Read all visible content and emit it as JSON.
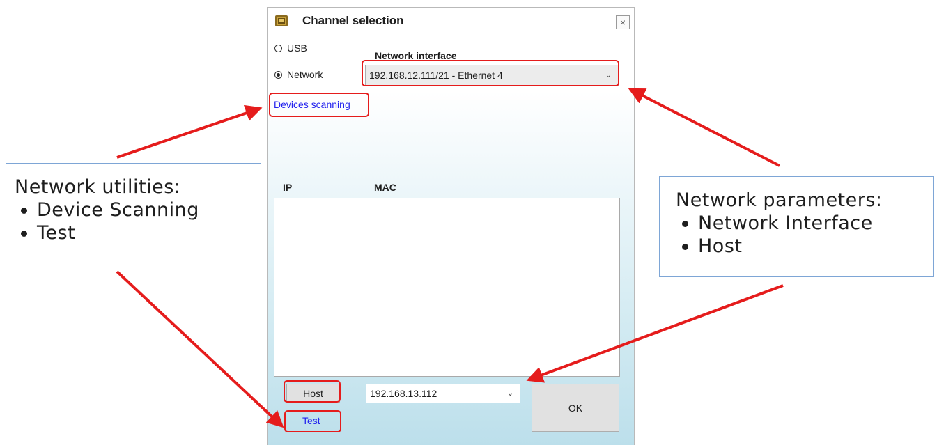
{
  "dialog": {
    "title": "Channel selection",
    "close_symbol": "×",
    "app_icon": "module-icon"
  },
  "channel": {
    "usb_label": "USB",
    "network_label": "Network",
    "selected": "Network"
  },
  "network_interface": {
    "label": "Network interface",
    "value": "192.168.12.111/21 - Ethernet 4"
  },
  "devices_scanning_label": "Devices scanning",
  "device_table": {
    "columns": [
      "IP",
      "MAC"
    ],
    "rows": []
  },
  "host": {
    "button_label": "Host",
    "value": "192.168.13.112"
  },
  "test_label": "Test",
  "ok_label": "OK",
  "callouts": {
    "utilities": {
      "title": "Network utilities:",
      "items": [
        "Device Scanning",
        "Test"
      ]
    },
    "parameters": {
      "title": "Network parameters:",
      "items": [
        "Network Interface",
        "Host"
      ]
    }
  },
  "colors": {
    "highlight": "#e51c1c",
    "arrow": "#e51c1c",
    "link": "#2222ee",
    "callout_border": "#7ea6d6"
  }
}
